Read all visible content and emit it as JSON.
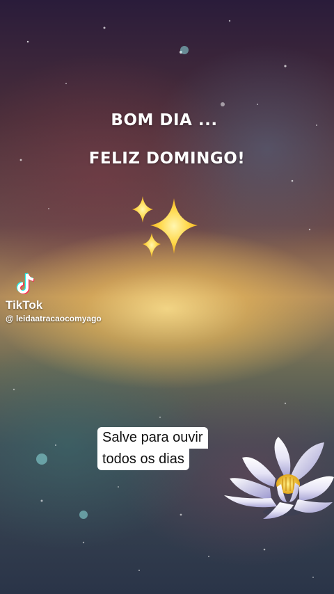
{
  "greeting": {
    "line1": "BOM DIA ...",
    "line2": "FELIZ DOMINGO!"
  },
  "watermark": {
    "brand": "TikTok",
    "handle": "@ leidaatracaocomyago",
    "icon": "tiktok-note-icon"
  },
  "caption": {
    "line1": "Salve para ouvir",
    "line2": "todos os dias"
  },
  "decorations": {
    "sparkles_icon": "sparkles-icon",
    "flower_icon": "lotus-flower-icon"
  },
  "colors": {
    "sparkle": "#ffd84a",
    "caption_bg": "#ffffff",
    "text": "#ffffff"
  }
}
